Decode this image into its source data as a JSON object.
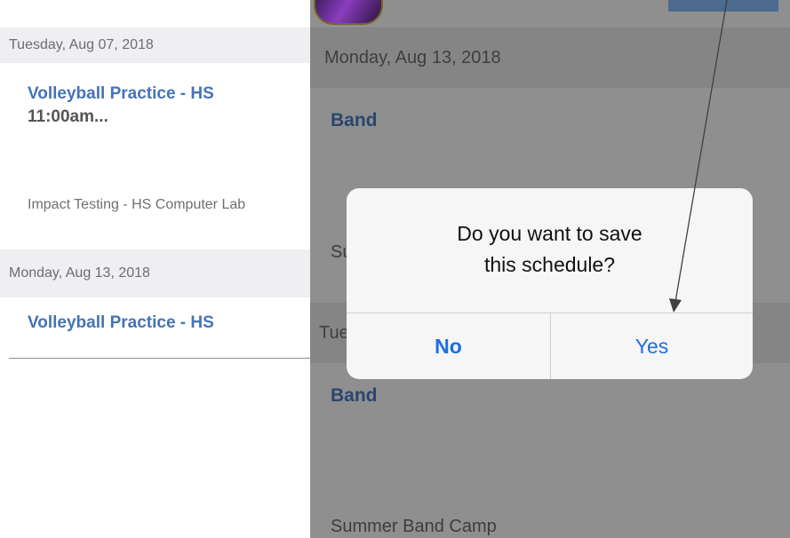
{
  "left_schedule": {
    "header_1": "Tuesday, Aug 07, 2018",
    "event_1_title": "Volleyball Practice - HS",
    "event_1_time": "11:00am...",
    "event_2_subtitle": "Impact Testing - HS Computer Lab",
    "header_2": "Monday, Aug 13, 2018",
    "event_3_title": "Volleyball Practice - HS"
  },
  "right_schedule": {
    "header_1": "Monday, Aug 13, 2018",
    "event_1_title": "Band",
    "partial_subtitle": "Su",
    "partial_header": "Tue",
    "event_2_title": "Band",
    "event_2_subtitle": "Summer Band Camp"
  },
  "alert": {
    "message_line_1": "Do you want to save",
    "message_line_2": "this schedule?",
    "no_label": "No",
    "yes_label": "Yes"
  },
  "colors": {
    "accent_blue": "#1b6fe0",
    "event_title_blue": "#4573b6",
    "overlay_gray": "#8f8f8f"
  }
}
